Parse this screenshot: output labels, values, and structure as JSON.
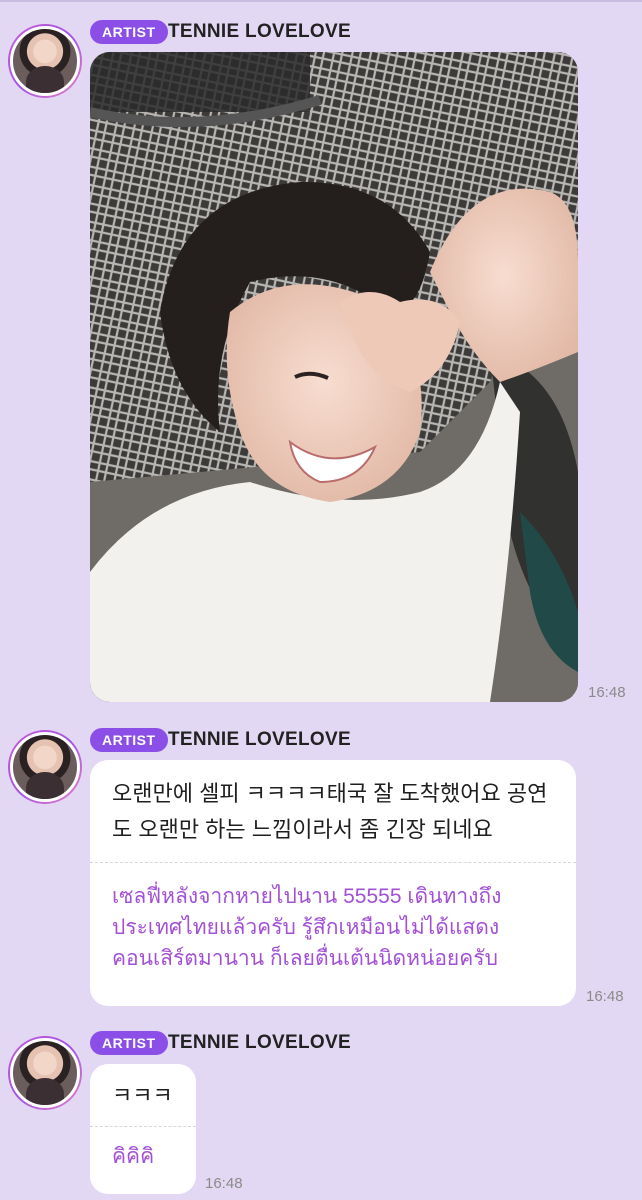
{
  "artist_badge": "ARTIST",
  "sender_name": "TENNIE LOVELOVE",
  "messages": [
    {
      "type": "photo",
      "time": "16:48"
    },
    {
      "type": "text",
      "original": "오랜만에 셀피 ㅋㅋㅋㅋ태국 잘 도착했어요 공연도 오랜만 하는 느낌이라서 좀 긴장 되네요",
      "translation": "เซลฟี่หลังจากหายไปนาน 55555 เดินทางถึงประเทศไทยแล้วครับ รู้สึกเหมือนไม่ได้แสดงคอนเสิร์ตมานาน ก็เลยตื่นเต้นนิดหน่อยครับ",
      "time": "16:48"
    },
    {
      "type": "text",
      "original": "ㅋㅋㅋ",
      "translation": "คิคิคิ",
      "time": "16:48"
    }
  ],
  "colors": {
    "background": "#e3d8f3",
    "badge": "#8b4fe8",
    "translation_text": "#a250d6"
  }
}
